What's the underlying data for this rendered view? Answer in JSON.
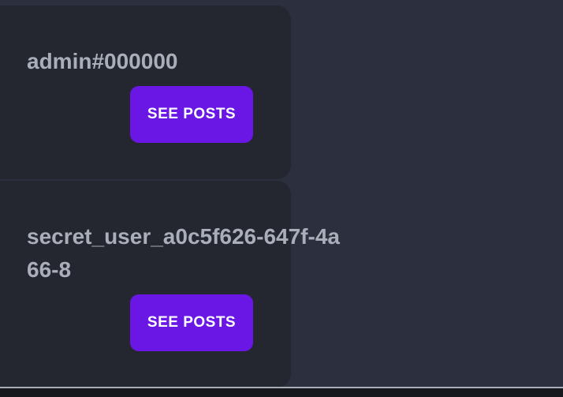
{
  "users": [
    {
      "username": "admin#000000",
      "button_label": "SEE POSTS"
    },
    {
      "username": "secret_user_a0c5f626-647f-4a66-8",
      "button_label": "SEE POSTS"
    }
  ],
  "colors": {
    "page_background": "#2c303e",
    "card_background": "#24272f",
    "username_text": "#a9aeba",
    "button_background": "#6a17e6",
    "button_text": "#ffffff"
  }
}
